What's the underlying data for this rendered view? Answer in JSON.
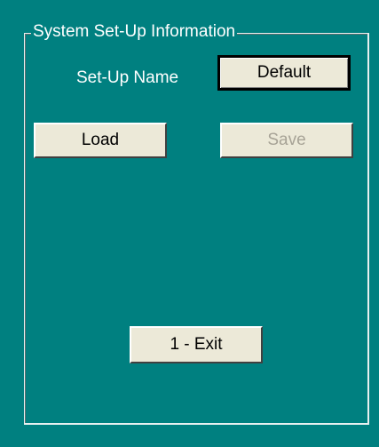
{
  "group": {
    "title": "System Set-Up Information"
  },
  "setup": {
    "name_label": "Set-Up Name",
    "name_value": "Default"
  },
  "buttons": {
    "load": "Load",
    "save": "Save",
    "exit": "1 - Exit"
  },
  "state": {
    "save_enabled": false
  },
  "colors": {
    "background": "#008080",
    "button_face": "#ece9d8",
    "disabled_text": "#a7a396",
    "label_text": "#ffffff"
  }
}
